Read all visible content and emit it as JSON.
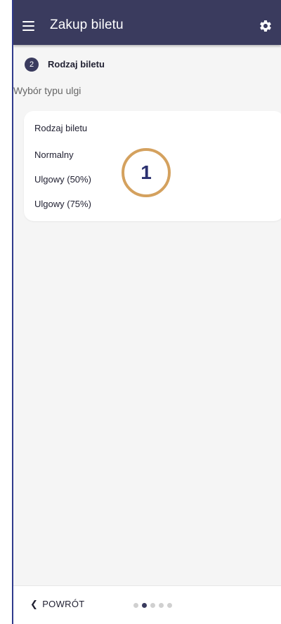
{
  "app_bar": {
    "title": "Zakup biletu",
    "menu_icon": "menu-icon",
    "settings_icon": "gear-icon",
    "color": "#3a3b5e"
  },
  "step": {
    "number": "2",
    "label": "Rodzaj biletu"
  },
  "subtitle": "Wybór typu ulgi",
  "ticket_card": {
    "title": "Rodzaj biletu",
    "options": [
      {
        "label": "Normalny"
      },
      {
        "label": "Ulgowy (50%)"
      },
      {
        "label": "Ulgowy (75%)"
      }
    ]
  },
  "annotation_marker": "1",
  "bottom_bar": {
    "back_icon": "chevron-left-icon",
    "back_label": "POWRÓT",
    "pager": {
      "total": 5,
      "active_index": 1
    }
  },
  "colors": {
    "accent": "#3a3b5e",
    "marker": "#d4a15e",
    "background": "#f5f5f5"
  }
}
